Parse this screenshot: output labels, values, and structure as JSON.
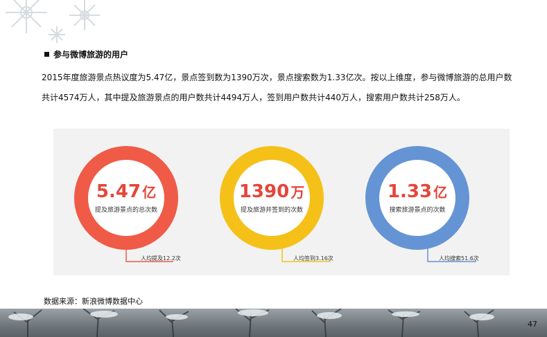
{
  "heading": "参与微博旅游的用户",
  "paragraph_line1": "2015年度旅游景点热议度为5.47亿，景点签到数为1390万次，景点搜索数为1.33亿次。按以上维度，参与微博旅游的总用户数",
  "paragraph_line2": "共计4574万人，其中提及旅游景点的用户数共计4494万人，签到用户数共计440万人，搜索用户数共计258万人。",
  "stats": [
    {
      "number": "5.47",
      "unit": "亿",
      "label": "提及旅游景点的总次数",
      "note": "人均提及12.2次",
      "color": "#ef5b47"
    },
    {
      "number": "1390",
      "unit": "万",
      "label": "提及旅游并签到的次数",
      "note": "人均签到3.16次",
      "color": "#f5c118"
    },
    {
      "number": "1.33",
      "unit": "亿",
      "label": "搜索旅游景点的次数",
      "note": "人均搜索51.6次",
      "color": "#6494d4"
    }
  ],
  "number_colors": [
    "#e5463a",
    "#e5463a",
    "#e5463a"
  ],
  "source": "数据来源：新浪微博数据中心",
  "page_number": "47"
}
